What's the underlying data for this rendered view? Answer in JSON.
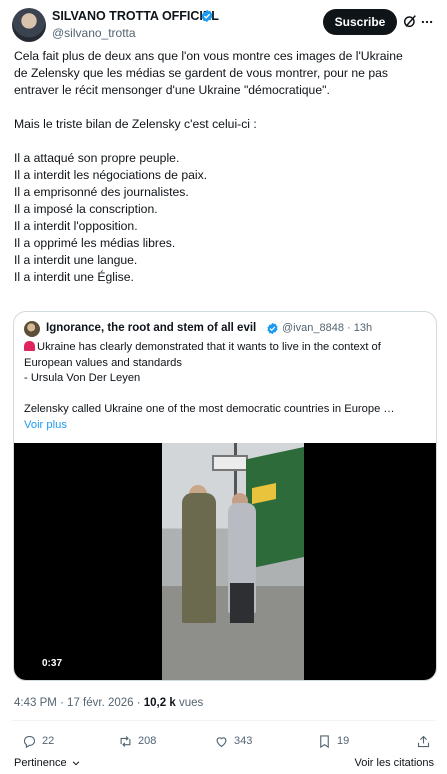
{
  "author": {
    "name": "SILVANO TROTTA OFFICIEL",
    "handle": "@silvano_trotta",
    "follow_label": "Suscribe"
  },
  "tweet": {
    "lines": [
      "Cela fait plus de deux ans que l'on vous montre ces images de l'Ukraine",
      "de Zelensky que les médias se gardent de vous montrer, pour ne pas",
      "entraver le récit mensonger d'une Ukraine \"démocratique\".",
      "",
      "Mais le triste bilan de Zelensky c'est celui-ci :",
      "",
      "Il a attaqué son propre peuple.",
      "Il a interdit les négociations de paix.",
      "Il a emprisonné des journalistes.",
      "Il a imposé la conscription.",
      "Il a interdit l'opposition.",
      "Il a opprimé les médias libres.",
      "Il a interdit une langue.",
      "Il a interdit une Église."
    ]
  },
  "quote": {
    "name": "Ignorance, the root and stem of all evil",
    "handle": "@ivan_8848 · 13h",
    "lines": [
      "Ukraine has clearly demonstrated that it wants to live in the context of",
      "European values and standards",
      " - Ursula Von Der Leyen",
      "",
      "Zelensky called Ukraine one of the most democratic countries in Europe  …"
    ],
    "read_more": "Voir plus",
    "video_duration": "0:37"
  },
  "meta": {
    "time_date": "4:43 PM · 17 févr. 2026 · ",
    "views_count": "10,2 k",
    "views_label": " vues"
  },
  "actions": {
    "replies": "22",
    "reposts": "208",
    "likes": "343",
    "bookmarks": "19"
  },
  "bottom": {
    "relevance_label": "Pertinence",
    "quotes_label": "Voir les citations"
  },
  "colors": {
    "accent": "#1d9bf0",
    "text": "#0f1419",
    "muted": "#536471"
  }
}
